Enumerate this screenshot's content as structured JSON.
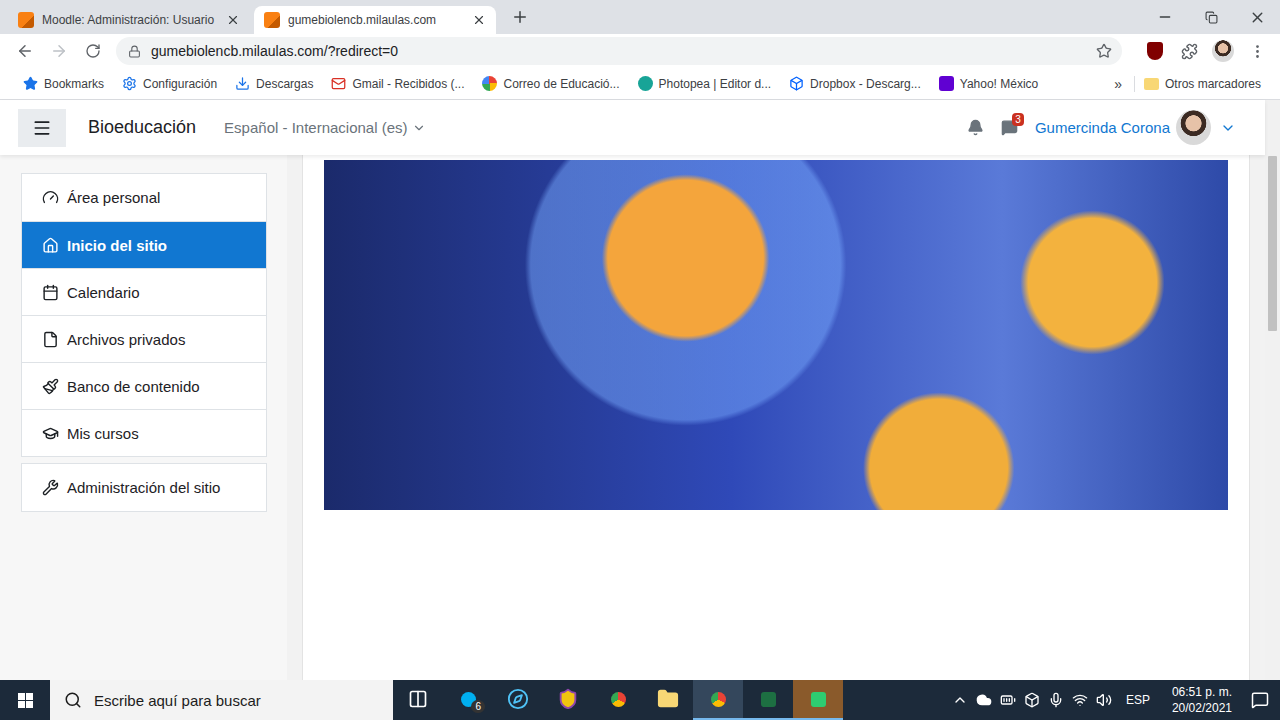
{
  "browser": {
    "tabs": [
      {
        "label": "Moodle: Administración: Usuario",
        "selected": false
      },
      {
        "label": "gumebiolencb.milaulas.com",
        "selected": true
      }
    ],
    "address": "gumebiolencb.milaulas.com/?redirect=0",
    "bookmarks": [
      "Bookmarks",
      "Configuración",
      "Descargas",
      "Gmail - Recibidos (...",
      "Correo de Educació...",
      "Photopea | Editor d...",
      "Dropbox - Descarg...",
      "Yahoo! México"
    ],
    "bookmarks_more": "»",
    "other_bookmarks": "Otros marcadores"
  },
  "navbar": {
    "site_name": "Bioeducación",
    "language": "Español - Internacional (es)",
    "messages_badge": "3",
    "user": "Gumercinda Corona"
  },
  "sidebar": {
    "items": [
      {
        "label": "Área personal",
        "selected": false
      },
      {
        "label": "Inicio del sitio",
        "selected": true
      },
      {
        "label": "Calendario",
        "selected": false
      },
      {
        "label": "Archivos privados",
        "selected": false
      },
      {
        "label": "Banco de contenido",
        "selected": false
      },
      {
        "label": "Mis cursos",
        "selected": false
      }
    ],
    "admin_items": [
      {
        "label": "Administración del sitio",
        "selected": false
      }
    ]
  },
  "taskbar": {
    "search_placeholder": "Escribe aquí para buscar",
    "skype_badge": "6",
    "language": "ESP",
    "time": "06:51 p. m.",
    "date": "20/02/2021"
  }
}
